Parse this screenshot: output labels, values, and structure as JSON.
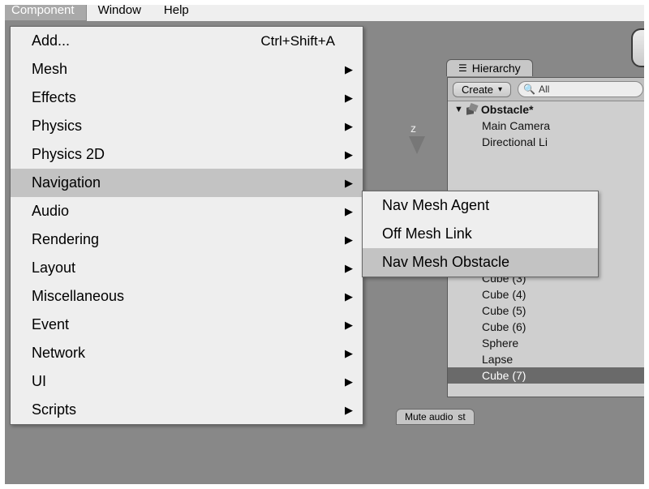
{
  "menubar": {
    "component": "Component",
    "window": "Window",
    "help": "Help"
  },
  "component_menu": {
    "add": {
      "label": "Add...",
      "accel": "Ctrl+Shift+A"
    },
    "mesh": "Mesh",
    "effects": "Effects",
    "physics": "Physics",
    "physics2d": "Physics 2D",
    "navigation": "Navigation",
    "audio": "Audio",
    "rendering": "Rendering",
    "layout": "Layout",
    "miscellaneous": "Miscellaneous",
    "event": "Event",
    "network": "Network",
    "ui": "UI",
    "scripts": "Scripts"
  },
  "navigation_submenu": {
    "agent": "Nav Mesh Agent",
    "offmesh": "Off Mesh Link",
    "obstacle": "Nav Mesh Obstacle"
  },
  "hierarchy": {
    "tab": "Hierarchy",
    "create": "Create",
    "search_placeholder": "All",
    "root": "Obstacle*",
    "item_camera": "Main Camera",
    "item_light": "Directional Li",
    "item_cube3": "Cube (3)",
    "item_cube4": "Cube (4)",
    "item_cube5": "Cube (5)",
    "item_cube6": "Cube (6)",
    "item_sphere": "Sphere",
    "item_lapse": "Lapse",
    "item_cube7": "Cube (7)"
  },
  "scene": {
    "z": "z",
    "mute_audio": "Mute audio",
    "st": "st"
  }
}
